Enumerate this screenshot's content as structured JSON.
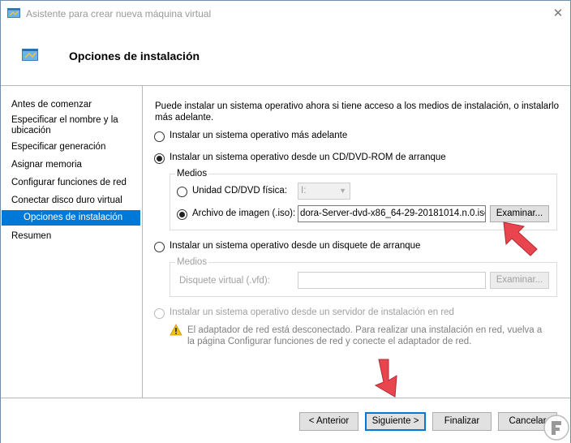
{
  "window": {
    "title": "Asistente para crear nueva máquina virtual",
    "close_glyph": "✕"
  },
  "header": {
    "title": "Opciones de instalación"
  },
  "nav": {
    "items": [
      {
        "label": "Antes de comenzar"
      },
      {
        "label": "Especificar el nombre y la ubicación"
      },
      {
        "label": "Especificar generación"
      },
      {
        "label": "Asignar memoria"
      },
      {
        "label": "Configurar funciones de red"
      },
      {
        "label": "Conectar disco duro virtual"
      },
      {
        "label": "Opciones de instalación",
        "active": true
      },
      {
        "label": "Resumen"
      }
    ]
  },
  "content": {
    "intro": "Puede instalar un sistema operativo ahora si tiene acceso a los medios de instalación, o instalarlo más adelante.",
    "option_later": "Instalar un sistema operativo más adelante",
    "option_cd": "Instalar un sistema operativo desde un CD/DVD-ROM de arranque",
    "cd_group": {
      "legend": "Medios",
      "physical_label": "Unidad CD/DVD física:",
      "physical_value": "I:",
      "image_label": "Archivo de imagen (.iso):",
      "image_value": "dora-Server-dvd-x86_64-29-20181014.n.0.iso",
      "browse": "Examinar..."
    },
    "option_floppy": "Instalar un sistema operativo desde un disquete de arranque",
    "floppy_group": {
      "legend": "Medios",
      "disk_label": "Disquete virtual (.vfd):",
      "disk_value": "",
      "browse": "Examinar..."
    },
    "option_network": "Instalar un sistema operativo desde un servidor de instalación en red",
    "network_warning": "El adaptador de red está desconectado. Para realizar una instalación en red, vuelva a la página Configurar funciones de red y conecte el adaptador de red."
  },
  "footer": {
    "back": "< Anterior",
    "next": "Siguiente >",
    "finish": "Finalizar",
    "cancel": "Cancelar"
  },
  "colors": {
    "accent": "#0078d7",
    "annotation_arrow": "#e8454e"
  },
  "icons": [
    "wizard-window-icon",
    "close-icon",
    "warning-icon",
    "red-arrow-annotation",
    "watermark-logo-icon"
  ]
}
